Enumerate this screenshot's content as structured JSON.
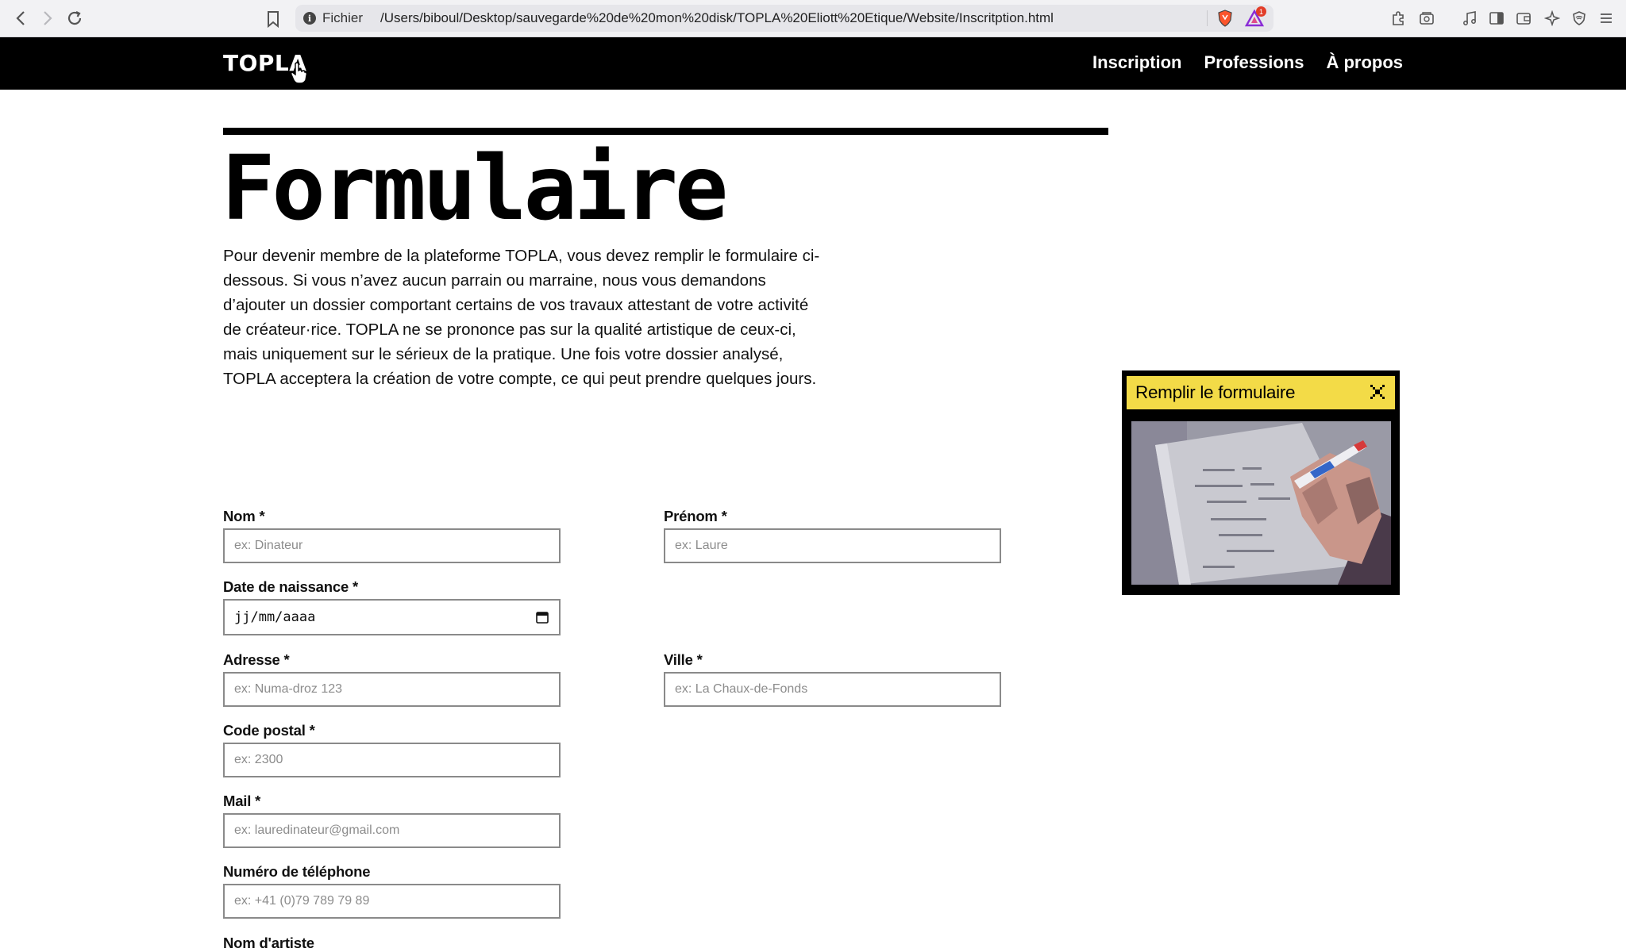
{
  "browser": {
    "scheme_label": "Fichier",
    "url_path": "/Users/biboul/Desktop/sauvegarde%20de%20mon%20disk/TOPLA%20Eliott%20Etique/Website/Inscritption.html",
    "rewards_badge": "1"
  },
  "header": {
    "logo": "TOPLA",
    "nav": [
      "Inscription",
      "Professions",
      "À propos"
    ]
  },
  "main": {
    "title": "Formulaire",
    "intro": "Pour devenir membre de la plateforme TOPLA, vous devez remplir le formulaire ci-dessous. Si vous n’avez aucun parrain ou marraine, nous vous demandons d’ajouter un dossier comportant certains de vos travaux attestant de votre activité de créateur·rice. TOPLA ne se prononce pas sur la qualité artistique de ceux-ci, mais uniquement sur le sérieux de la pratique. Une fois votre dossier analysé, TOPLA acceptera la création de votre compte, ce qui peut prendre quelques jours."
  },
  "form": {
    "nom": {
      "label": "Nom *",
      "placeholder": "ex: Dinateur"
    },
    "prenom": {
      "label": "Prénom *",
      "placeholder": "ex: Laure"
    },
    "naissance": {
      "label": "Date de naissance *",
      "value": "jj/mm/aaaa"
    },
    "adresse": {
      "label": "Adresse *",
      "placeholder": "ex: Numa-droz 123"
    },
    "ville": {
      "label": "Ville *",
      "placeholder": "ex: La Chaux-de-Fonds"
    },
    "code_postal": {
      "label": "Code postal *",
      "placeholder": "ex: 2300"
    },
    "mail": {
      "label": "Mail *",
      "placeholder": "ex: lauredinateur@gmail.com"
    },
    "telephone": {
      "label": "Numéro de téléphone",
      "placeholder": "ex: +41 (0)79 789 79 89"
    },
    "artiste": {
      "label": "Nom d'artiste"
    }
  },
  "popup": {
    "title": "Remplir le formulaire",
    "accent": "#f3db47"
  }
}
